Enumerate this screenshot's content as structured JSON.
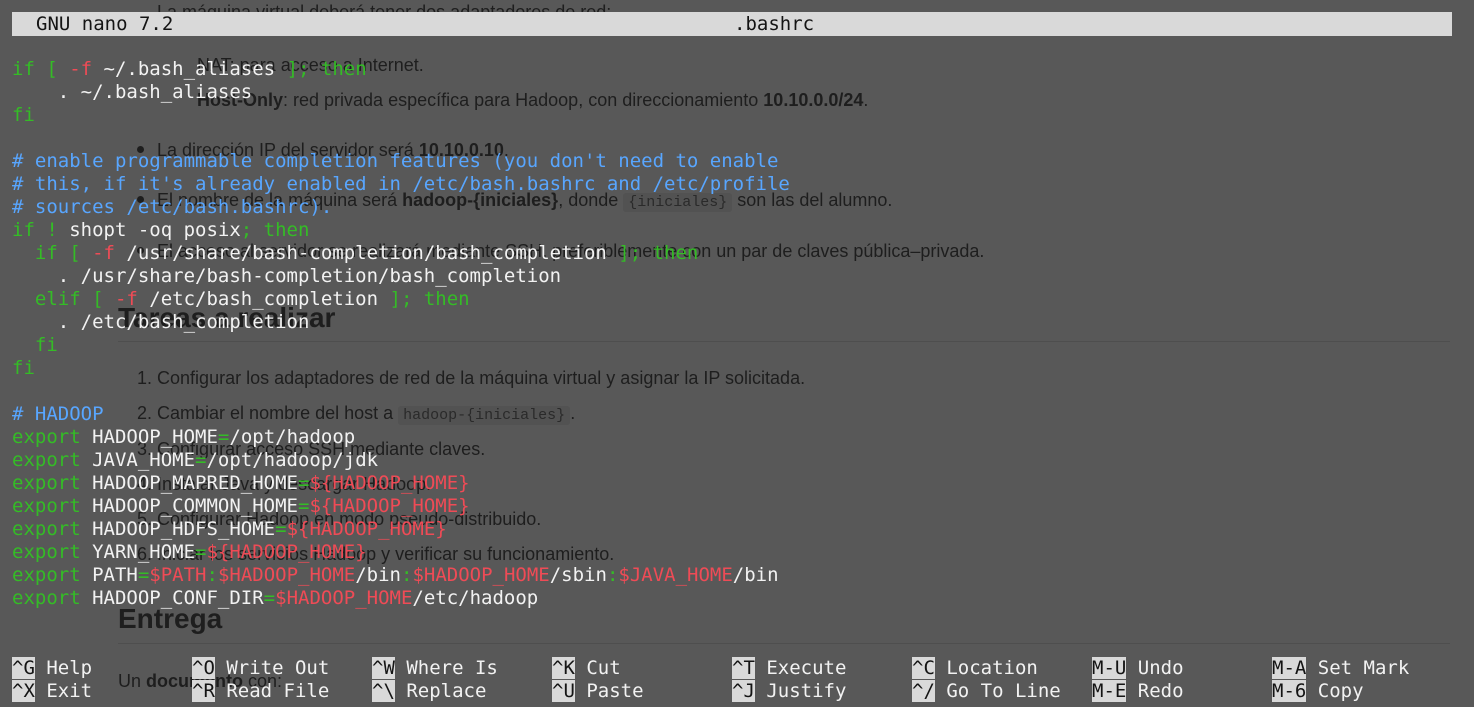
{
  "background_document": {
    "lines": [
      {
        "prefix": "La máquina virtual deberá tener dos adaptadores de red:"
      },
      {
        "prefix": "NAT: para acceso a Internet."
      },
      {
        "prefix": "Host-Only",
        "suffix": ": red privada específica para Hadoop, con direccionamiento ",
        "strong": "10.10.0.0/24",
        "end": "."
      },
      {
        "prefix": "La dirección IP del servidor será ",
        "strong": "10.10.0.10",
        "end": "."
      },
      {
        "prefix": "El nombre de la máquina será ",
        "strong": "hadoop-{iniciales}",
        "mid": ", donde ",
        "code": "{iniciales}",
        "end": " son las del alumno."
      },
      {
        "prefix": "El acceso al servidor se realizará mediante SSH, preferiblemente con un par de claves pública–privada."
      }
    ],
    "heading_tasks": "Tareas a realizar",
    "tasks": [
      {
        "num": "1.",
        "text": "Configurar los adaptadores de red de la máquina virtual y asignar la IP solicitada."
      },
      {
        "num": "2.",
        "text": "Cambiar el nombre del host a ",
        "code": "hadoop-{iniciales}",
        "end": "."
      },
      {
        "num": "3.",
        "text": "Configurar acceso SSH mediante claves."
      },
      {
        "num": "4.",
        "text": "Instalar Java y descargar Hadoop."
      },
      {
        "num": "5.",
        "text": "Configurar Hadoop en modo pseudo-distribuido."
      },
      {
        "num": "6.",
        "text": "Iniciar los servicios Hadoop y verificar su funcionamiento."
      }
    ],
    "heading_delivery": "Entrega",
    "delivery_text_prefix": "Un ",
    "delivery_text_strong": "documento",
    "delivery_text_suffix": " con:"
  },
  "nano": {
    "version": "GNU nano 7.2",
    "filename": ".bashrc",
    "lines": [
      [
        [
          "kw",
          "if [ "
        ],
        [
          "var",
          "-f"
        ],
        [
          "def",
          " ~/.bash_aliases "
        ],
        [
          "kw",
          "]; then"
        ]
      ],
      [
        [
          "def",
          "    . ~/.bash_aliases"
        ]
      ],
      [
        [
          "kw",
          "fi"
        ]
      ],
      [
        [
          "def",
          ""
        ]
      ],
      [
        [
          "com",
          "# enable programmable completion features (you don't need to enable"
        ]
      ],
      [
        [
          "com",
          "# this, if it's already enabled in /etc/bash.bashrc and /etc/profile"
        ]
      ],
      [
        [
          "com",
          "# sources /etc/bash.bashrc)."
        ]
      ],
      [
        [
          "kw",
          "if ! "
        ],
        [
          "def",
          "shopt -oq posix"
        ],
        [
          "kw",
          "; then"
        ]
      ],
      [
        [
          "kw",
          "  if [ "
        ],
        [
          "var",
          "-f"
        ],
        [
          "def",
          " /usr/share/bash-completion/bash_completion "
        ],
        [
          "kw",
          "]; then"
        ]
      ],
      [
        [
          "def",
          "    . /usr/share/bash-completion/bash_completion"
        ]
      ],
      [
        [
          "kw",
          "  elif [ "
        ],
        [
          "var",
          "-f"
        ],
        [
          "def",
          " /etc/bash_completion "
        ],
        [
          "kw",
          "]; then"
        ]
      ],
      [
        [
          "def",
          "    . /etc/bash_completion"
        ]
      ],
      [
        [
          "kw",
          "  fi"
        ]
      ],
      [
        [
          "kw",
          "fi"
        ]
      ],
      [
        [
          "def",
          ""
        ]
      ],
      [
        [
          "com",
          "# HADOOP"
        ]
      ],
      [
        [
          "kw",
          "export "
        ],
        [
          "def",
          "HADOOP_HOME"
        ],
        [
          "kw",
          "="
        ],
        [
          "def",
          "/opt/hadoop"
        ]
      ],
      [
        [
          "kw",
          "export "
        ],
        [
          "def",
          "JAVA_HOME"
        ],
        [
          "kw",
          "="
        ],
        [
          "def",
          "/opt/hadoop/jdk"
        ]
      ],
      [
        [
          "kw",
          "export "
        ],
        [
          "def",
          "HADOOP_MAPRED_HOME"
        ],
        [
          "kw",
          "="
        ],
        [
          "var",
          "${HADOOP_HOME}"
        ]
      ],
      [
        [
          "kw",
          "export "
        ],
        [
          "def",
          "HADOOP_COMMON_HOME"
        ],
        [
          "kw",
          "="
        ],
        [
          "var",
          "${HADOOP_HOME}"
        ]
      ],
      [
        [
          "kw",
          "export "
        ],
        [
          "def",
          "HADOOP_HDFS_HOME"
        ],
        [
          "kw",
          "="
        ],
        [
          "var",
          "${HADOOP_HOME}"
        ]
      ],
      [
        [
          "kw",
          "export "
        ],
        [
          "def",
          "YARN_HOME"
        ],
        [
          "kw",
          "="
        ],
        [
          "var",
          "${HADOOP_HOME}"
        ]
      ],
      [
        [
          "kw",
          "export "
        ],
        [
          "def",
          "PATH"
        ],
        [
          "kw",
          "="
        ],
        [
          "var",
          "$PATH"
        ],
        [
          "kw",
          ":"
        ],
        [
          "var",
          "$HADOOP_HOME"
        ],
        [
          "def",
          "/bin"
        ],
        [
          "kw",
          ":"
        ],
        [
          "var",
          "$HADOOP_HOME"
        ],
        [
          "def",
          "/sbin"
        ],
        [
          "kw",
          ":"
        ],
        [
          "var",
          "$JAVA_HOME"
        ],
        [
          "def",
          "/bin"
        ]
      ],
      [
        [
          "kw",
          "export "
        ],
        [
          "def",
          "HADOOP_CONF_DIR"
        ],
        [
          "kw",
          "="
        ],
        [
          "var",
          "$HADOOP_HOME"
        ],
        [
          "def",
          "/etc/hadoop"
        ]
      ]
    ],
    "shortcuts": [
      {
        "key": "^G",
        "label": "Help"
      },
      {
        "key": "^X",
        "label": "Exit"
      },
      {
        "key": "^O",
        "label": "Write Out"
      },
      {
        "key": "^R",
        "label": "Read File"
      },
      {
        "key": "^W",
        "label": "Where Is"
      },
      {
        "key": "^\\",
        "label": "Replace"
      },
      {
        "key": "^K",
        "label": "Cut"
      },
      {
        "key": "^U",
        "label": "Paste"
      },
      {
        "key": "^T",
        "label": "Execute"
      },
      {
        "key": "^J",
        "label": "Justify"
      },
      {
        "key": "^C",
        "label": "Location"
      },
      {
        "key": "^/",
        "label": "Go To Line"
      },
      {
        "key": "M-U",
        "label": "Undo"
      },
      {
        "key": "M-E",
        "label": "Redo"
      },
      {
        "key": "M-A",
        "label": "Set Mark"
      },
      {
        "key": "M-6",
        "label": "Copy"
      }
    ]
  },
  "colors": {
    "comment": "#58a6ff",
    "keyword": "#34bc26",
    "variable": "#ef4b56",
    "text": "#f2f2f2",
    "titlebar_bg": "#d9d9d9",
    "background": "#585858"
  }
}
